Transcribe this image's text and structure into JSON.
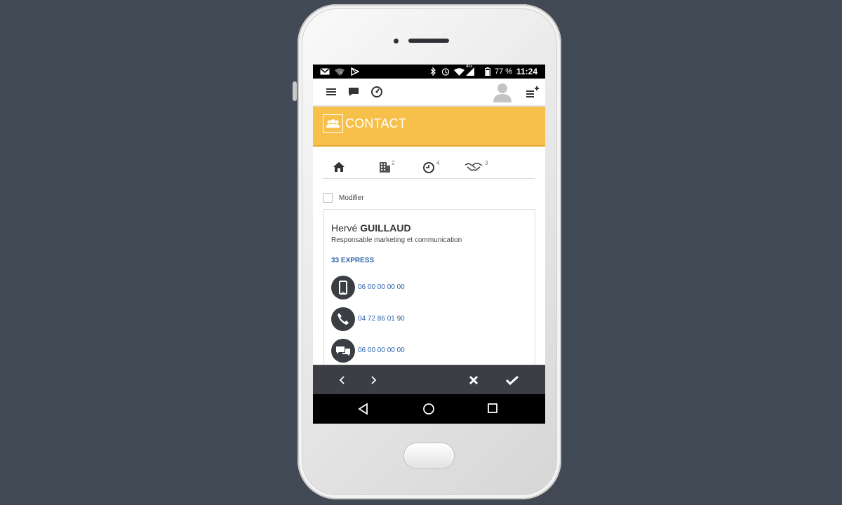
{
  "status_bar": {
    "battery": "77 %",
    "time": "11:24",
    "network": "4G"
  },
  "header": {
    "title": "CONTACT"
  },
  "tabs": [
    {
      "icon": "home-icon",
      "count": ""
    },
    {
      "icon": "building-icon",
      "count": "2"
    },
    {
      "icon": "clock-icon",
      "count": "4"
    },
    {
      "icon": "handshake-icon",
      "count": "3"
    }
  ],
  "modifier": {
    "label": "Modifier"
  },
  "contact": {
    "first_name": "Hervé",
    "last_name": "GUILLAUD",
    "role": "Responsable marketing et communication",
    "company": "33 EXPRESS",
    "mobile": "06 00 00 00 00",
    "phone": "04 72 86 01 90",
    "sms": "06 00 00 00 00"
  },
  "colors": {
    "accent": "#f7c04a",
    "link": "#2a62a8",
    "bar": "#3b3f45"
  }
}
